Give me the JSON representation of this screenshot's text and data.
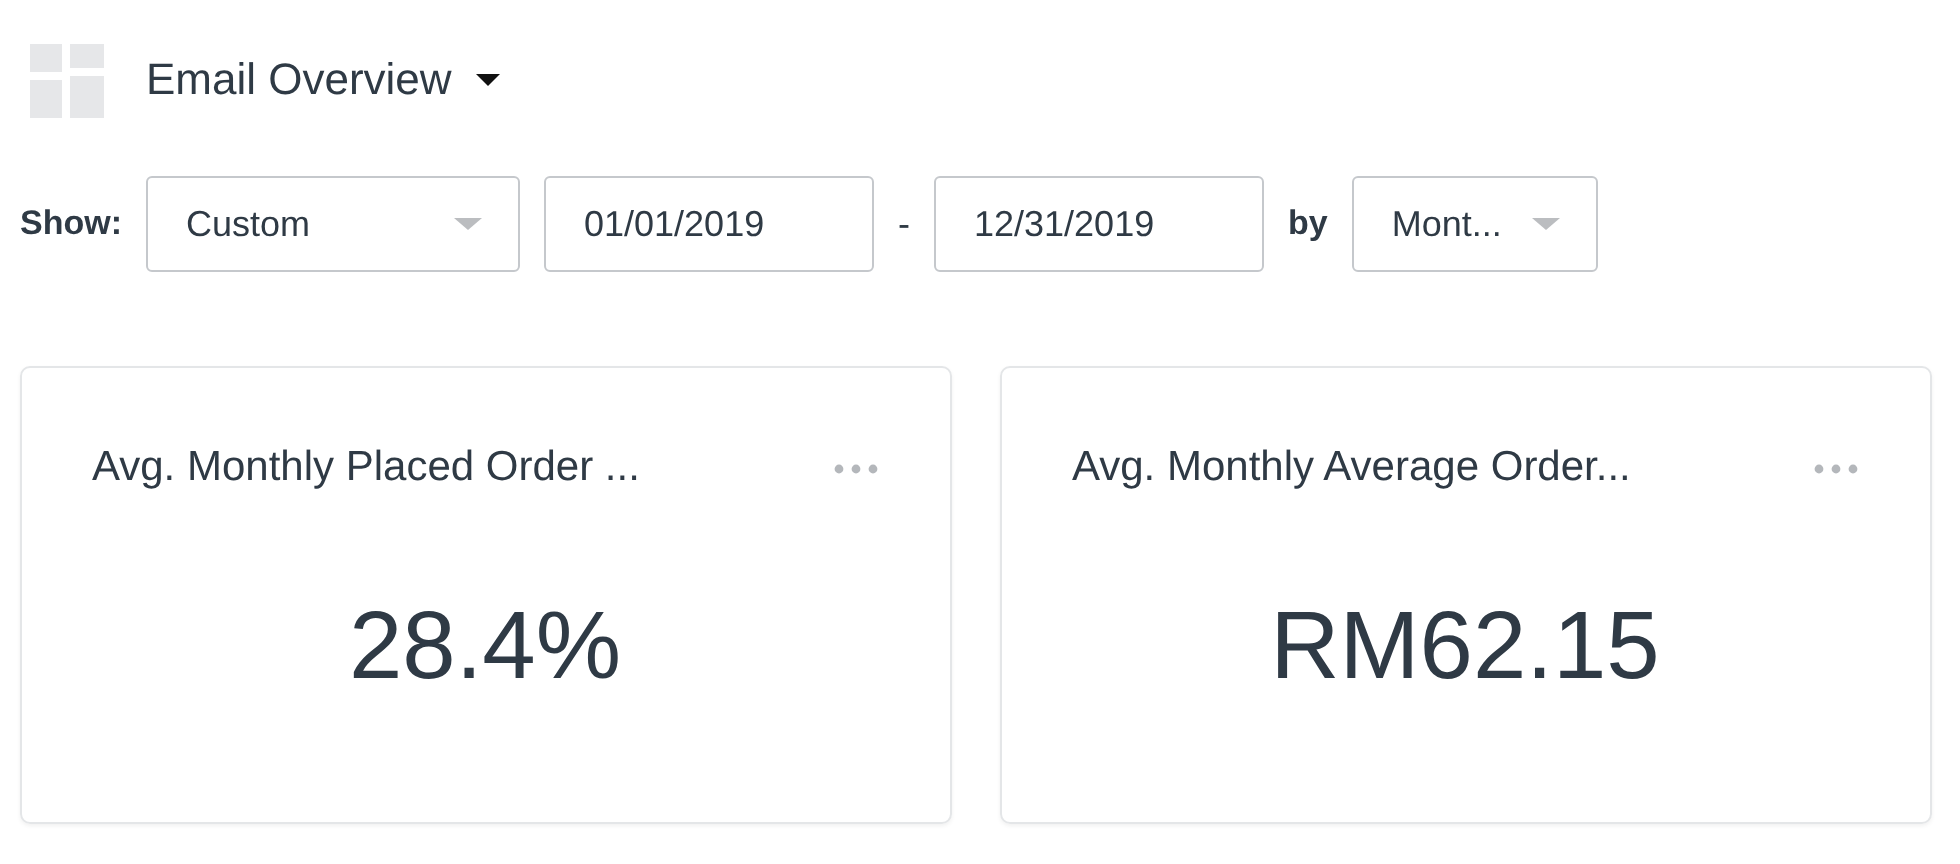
{
  "header": {
    "title": "Email Overview"
  },
  "filters": {
    "show_label": "Show:",
    "range": {
      "value": "Custom"
    },
    "start_date": {
      "value": "01/01/2019"
    },
    "separator": "-",
    "end_date": {
      "value": "12/31/2019"
    },
    "by_label": "by",
    "interval": {
      "value": "Mont..."
    }
  },
  "cards": [
    {
      "title": "Avg. Monthly Placed Order ...",
      "value": "28.4%"
    },
    {
      "title": "Avg. Monthly Average Order...",
      "value": "RM62.15"
    }
  ]
}
